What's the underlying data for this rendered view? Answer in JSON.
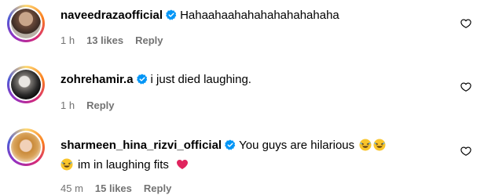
{
  "comments": [
    {
      "username": "naveedrazaofficial",
      "verified": true,
      "text": "Hahaahaahahahahahahahaha",
      "text_line2": "",
      "time": "1 h",
      "likes": "13 likes",
      "reply": "Reply",
      "avatar_icon": "avatar-photo"
    },
    {
      "username": "zohrehamir.a",
      "verified": true,
      "text": "i just died laughing.",
      "text_line2": "",
      "time": "1 h",
      "likes": "",
      "reply": "Reply",
      "avatar_icon": "avatar-photo"
    },
    {
      "username": "sharmeen_hina_rizvi_official",
      "verified": true,
      "text": "You guys are hilarious",
      "text_line2": "im in laughing fits",
      "time": "45 m",
      "likes": "15 likes",
      "reply": "Reply",
      "avatar_icon": "avatar-photo"
    }
  ],
  "icons": {
    "verified": "verified-badge-icon",
    "like": "heart-outline-icon",
    "laughing": "rolling-on-floor-laughing-emoji",
    "red_heart": "red-heart-emoji"
  },
  "colors": {
    "verified_blue": "#0095f6",
    "meta_gray": "#737373",
    "heart_red": "#e0245e"
  }
}
